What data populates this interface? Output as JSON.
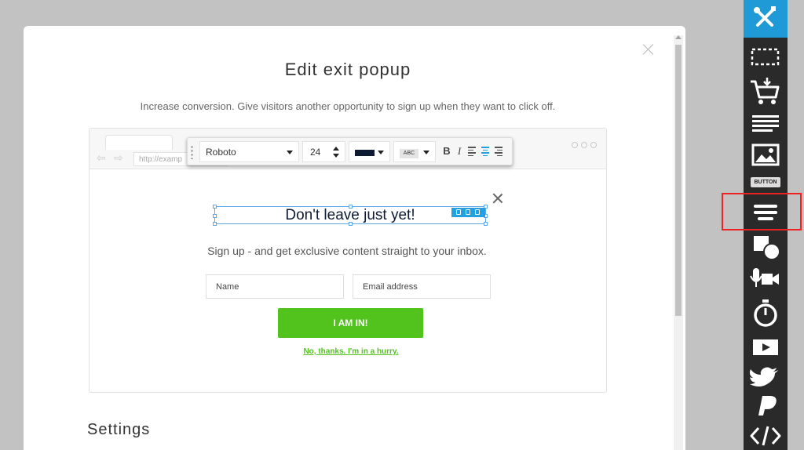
{
  "modal": {
    "title": "Edit exit popup",
    "subtitle": "Increase conversion. Give visitors another opportunity to sign up when they want to click off.",
    "settings_heading": "Settings"
  },
  "browser": {
    "url": "http://examp"
  },
  "format_toolbar": {
    "font": "Roboto",
    "size": "24",
    "text_color": "#0c1a33",
    "case_label": "ABC",
    "bold": "B",
    "italic": "I"
  },
  "popup": {
    "headline": "Don't leave just yet!",
    "subtext": "Sign up - and get exclusive content straight to your inbox.",
    "name_placeholder": "Name",
    "email_placeholder": "Email address",
    "cta_label": "I AM IN!",
    "decline_link": "No, thanks. I'm in a hurry."
  },
  "tools": {
    "button_label": "BUTTON",
    "items": [
      "settings-tools-icon",
      "selection-icon",
      "cart-icon",
      "text-icon",
      "image-icon",
      "button-icon",
      "form-icon",
      "shapes-icon",
      "media-icon",
      "timer-icon",
      "video-icon",
      "twitter-icon",
      "paypal-icon",
      "code-icon"
    ]
  },
  "colors": {
    "accent": "#1f9ad6",
    "cta": "#52c31d",
    "highlight": "#e22222"
  }
}
